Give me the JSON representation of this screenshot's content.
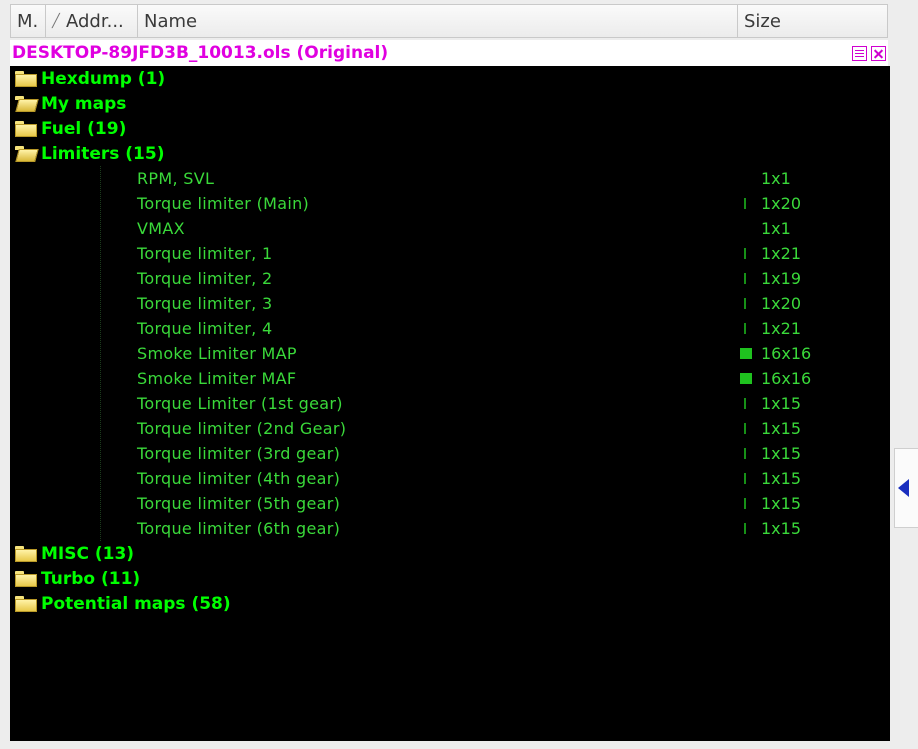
{
  "header": {
    "columns": [
      "M.",
      "Addr...",
      "Name",
      "Size"
    ]
  },
  "title": "DESKTOP-89JFD3B_10013.ols (Original)",
  "tree": [
    {
      "type": "folder",
      "label": "Hexdump (1)",
      "open": false
    },
    {
      "type": "folder",
      "label": "My maps",
      "open": true
    },
    {
      "type": "folder",
      "label": "Fuel (19)",
      "open": false
    },
    {
      "type": "folder",
      "label": "Limiters (15)",
      "open": true
    },
    {
      "type": "leaf",
      "name": "RPM, SVL",
      "size": "1x1",
      "bar": 0
    },
    {
      "type": "leaf",
      "name": "Torque limiter (Main)",
      "size": "1x20",
      "bar": 1
    },
    {
      "type": "leaf",
      "name": "VMAX",
      "size": "1x1",
      "bar": 0
    },
    {
      "type": "leaf",
      "name": "Torque limiter, 1",
      "size": "1x21",
      "bar": 1
    },
    {
      "type": "leaf",
      "name": "Torque limiter, 2",
      "size": "1x19",
      "bar": 1
    },
    {
      "type": "leaf",
      "name": "Torque limiter, 3",
      "size": "1x20",
      "bar": 1
    },
    {
      "type": "leaf",
      "name": "Torque limiter, 4",
      "size": "1x21",
      "bar": 1
    },
    {
      "type": "leaf",
      "name": "Smoke Limiter MAP",
      "size": "16x16",
      "bar": 2
    },
    {
      "type": "leaf",
      "name": "Smoke Limiter MAF",
      "size": "16x16",
      "bar": 2
    },
    {
      "type": "leaf",
      "name": "Torque Limiter (1st gear)",
      "size": "1x15",
      "bar": 1
    },
    {
      "type": "leaf",
      "name": "Torque limiter (2nd Gear)",
      "size": "1x15",
      "bar": 1
    },
    {
      "type": "leaf",
      "name": "Torque limiter (3rd gear)",
      "size": "1x15",
      "bar": 1
    },
    {
      "type": "leaf",
      "name": "Torque limiter (4th gear)",
      "size": "1x15",
      "bar": 1
    },
    {
      "type": "leaf",
      "name": "Torque limiter (5th gear)",
      "size": "1x15",
      "bar": 1
    },
    {
      "type": "leaf",
      "name": "Torque limiter (6th gear)",
      "size": "1x15",
      "bar": 1
    },
    {
      "type": "folder",
      "label": "MISC (13)",
      "open": false
    },
    {
      "type": "folder",
      "label": "Turbo (11)",
      "open": false
    },
    {
      "type": "folder",
      "label": "Potential maps (58)",
      "open": false
    }
  ],
  "colors": {
    "title": "#e000e0",
    "folder_text": "#00ff00",
    "leaf_text": "#3ad93a",
    "panel_bg": "#000000"
  },
  "icons": {
    "folder": "folder-icon",
    "folder_open": "folder-open-icon",
    "collapse": "collapse-arrow-icon"
  }
}
